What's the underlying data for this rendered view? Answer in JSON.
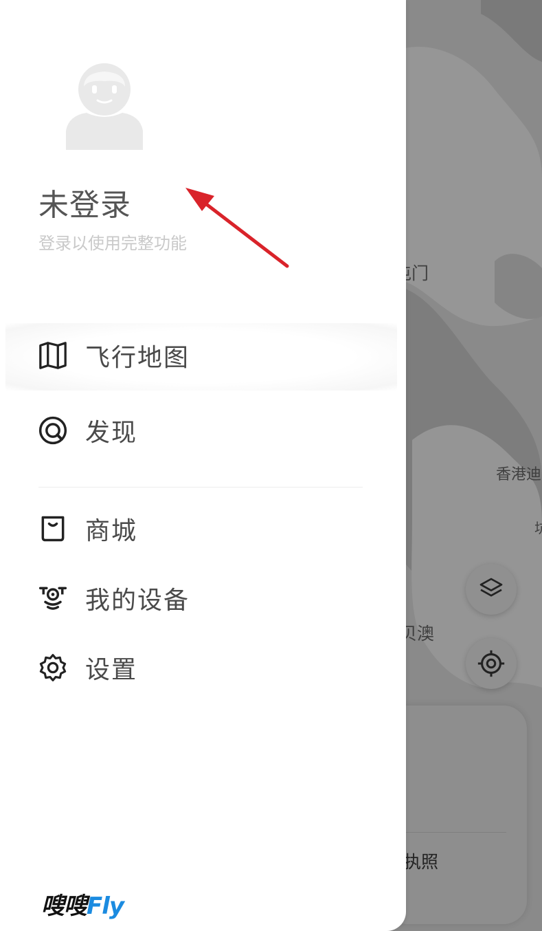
{
  "profile": {
    "name": "未登录",
    "subtitle": "登录以使用完整功能"
  },
  "menu": {
    "primary": [
      {
        "label": "飞行地图",
        "icon": "map-icon"
      },
      {
        "label": "发现",
        "icon": "discover-icon"
      }
    ],
    "secondary": [
      {
        "label": "商城",
        "icon": "shopping-bag-icon"
      },
      {
        "label": "我的设备",
        "icon": "drone-icon"
      },
      {
        "label": "设置",
        "icon": "gear-icon"
      }
    ]
  },
  "brand": {
    "part1": "嗖嗖",
    "part2": "Fly"
  },
  "map": {
    "labels": [
      "屯门",
      "香港迪",
      "贝澳",
      "坑"
    ],
    "card_text": "执照"
  },
  "colors": {
    "accent": "#1b8be0",
    "annotation_arrow": "#d9232a"
  }
}
